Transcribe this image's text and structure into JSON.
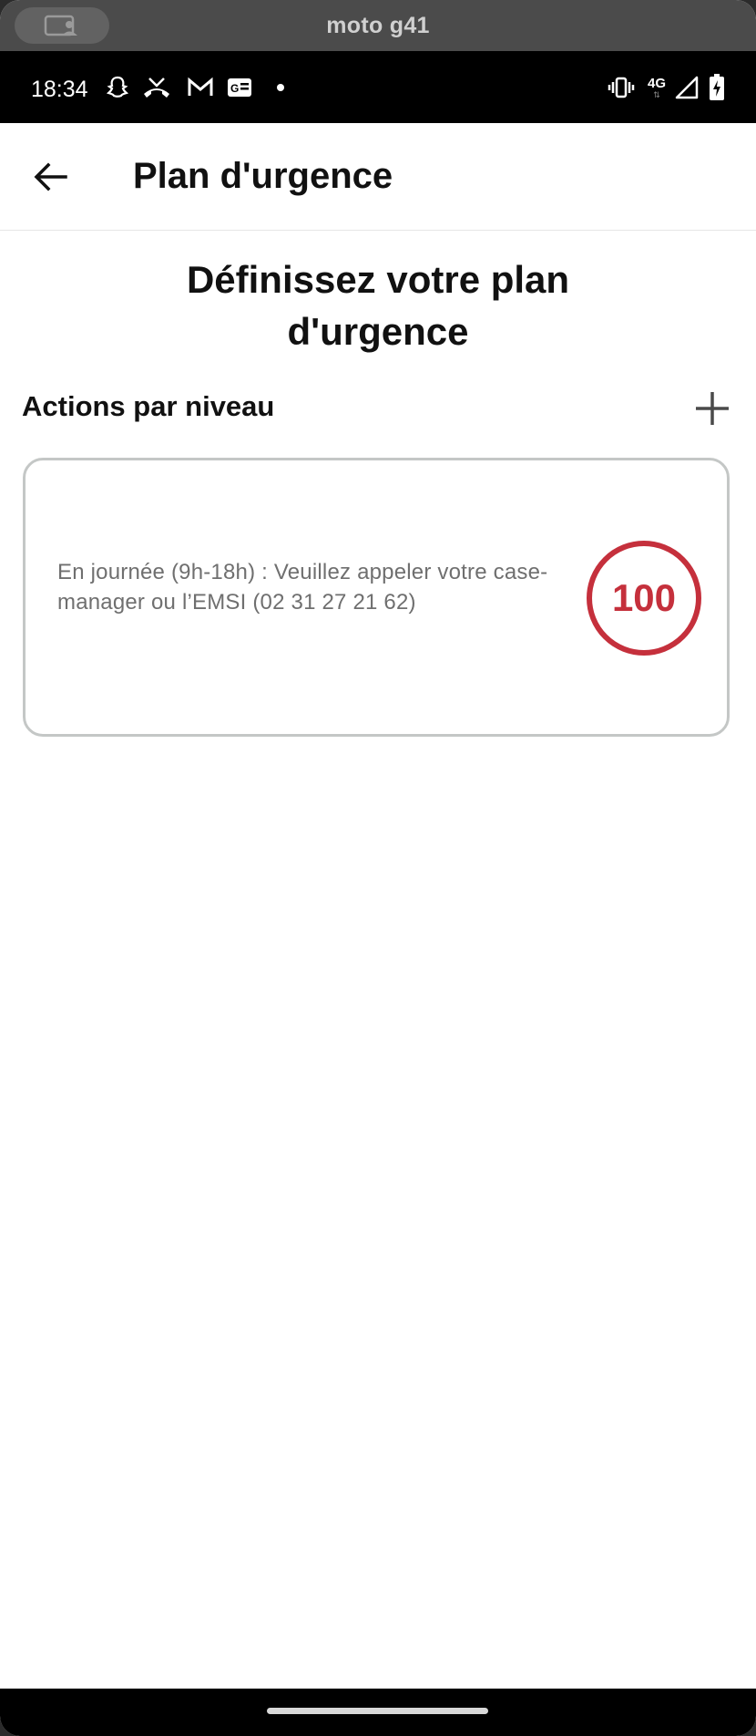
{
  "emulator": {
    "title": "moto g41"
  },
  "status_bar": {
    "time": "18:34",
    "network": "4G",
    "icons": [
      "snapchat-icon",
      "missed-call-icon",
      "gmail-icon",
      "news-icon",
      "notification-dot",
      "vibrate-icon",
      "signal-icon",
      "battery-charging-icon"
    ]
  },
  "app_bar": {
    "title": "Plan d'urgence",
    "back_icon": "arrow-back-icon"
  },
  "main": {
    "heading_line1": "Définissez votre plan",
    "heading_line2": "d'urgence",
    "section_title": "Actions par niveau",
    "add_icon": "plus-icon",
    "actions": [
      {
        "text": "En journée (9h-18h) : Veuillez appeler votre case-manager ou l’EMSI (02 31 27 21 62)",
        "level": "100",
        "level_color": "#c5303c"
      }
    ]
  }
}
